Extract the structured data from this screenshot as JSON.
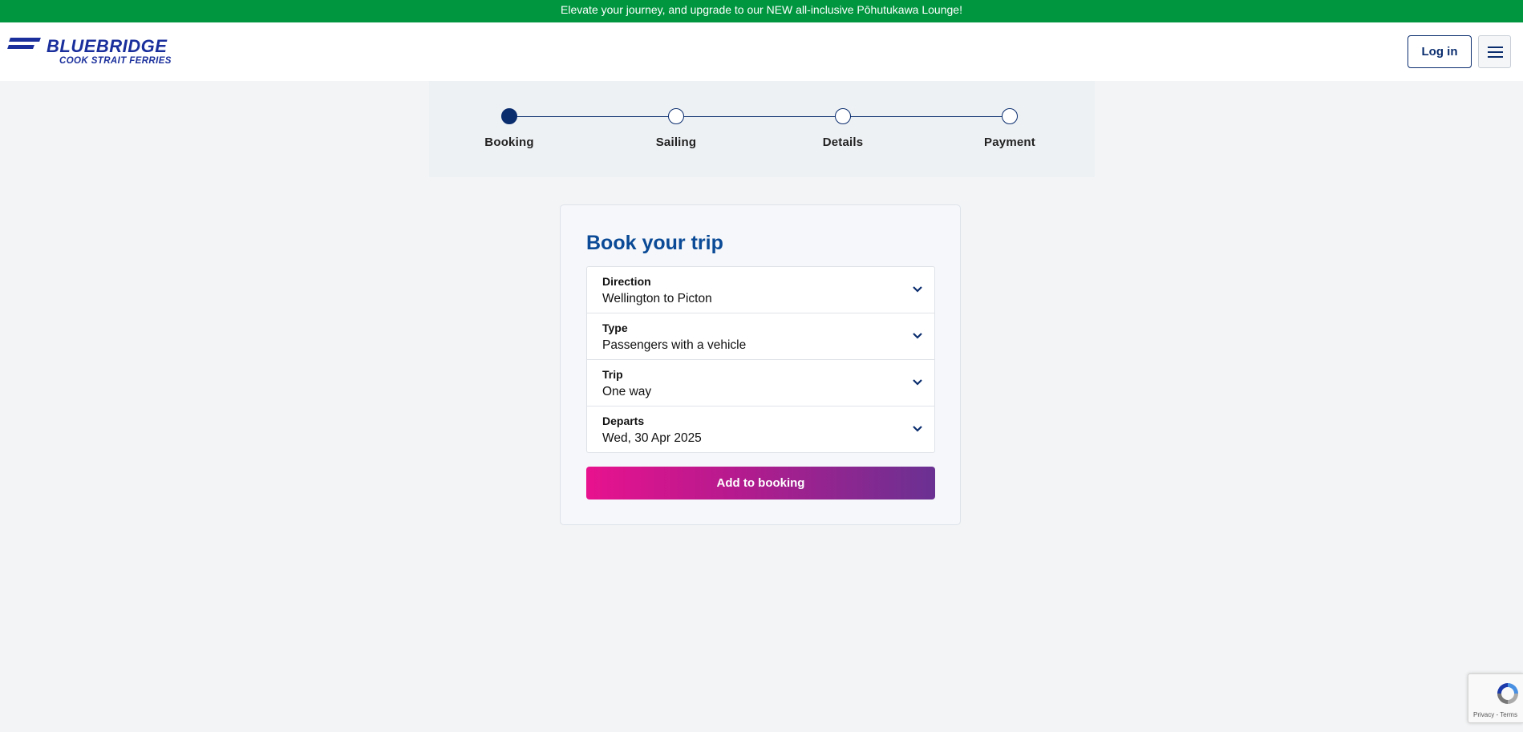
{
  "banner": {
    "text": "Elevate your journey, and upgrade to our NEW all-inclusive Pōhutukawa Lounge!"
  },
  "header": {
    "logo_title": "BLUEBRIDGE",
    "logo_subtitle": "COOK STRAIT FERRIES",
    "login_label": "Log in",
    "menu_icon": "hamburger-menu-icon"
  },
  "progress": {
    "steps": [
      {
        "label": "Booking",
        "active": true
      },
      {
        "label": "Sailing",
        "active": false
      },
      {
        "label": "Details",
        "active": false
      },
      {
        "label": "Payment",
        "active": false
      }
    ]
  },
  "booking": {
    "title": "Book your trip",
    "fields": [
      {
        "label": "Direction",
        "value": "Wellington to Picton"
      },
      {
        "label": "Type",
        "value": "Passengers with a vehicle"
      },
      {
        "label": "Trip",
        "value": "One way"
      },
      {
        "label": "Departs",
        "value": "Wed, 30 Apr 2025"
      }
    ],
    "submit_label": "Add to booking"
  },
  "recaptcha": {
    "links": "Privacy - Terms",
    "icon": "recaptcha-icon"
  },
  "colors": {
    "banner": "#00963f",
    "brand_navy": "#0a2d6e",
    "title_blue": "#0a4a96",
    "button_gradient_start": "#e8128e",
    "button_gradient_end": "#6a3192"
  }
}
